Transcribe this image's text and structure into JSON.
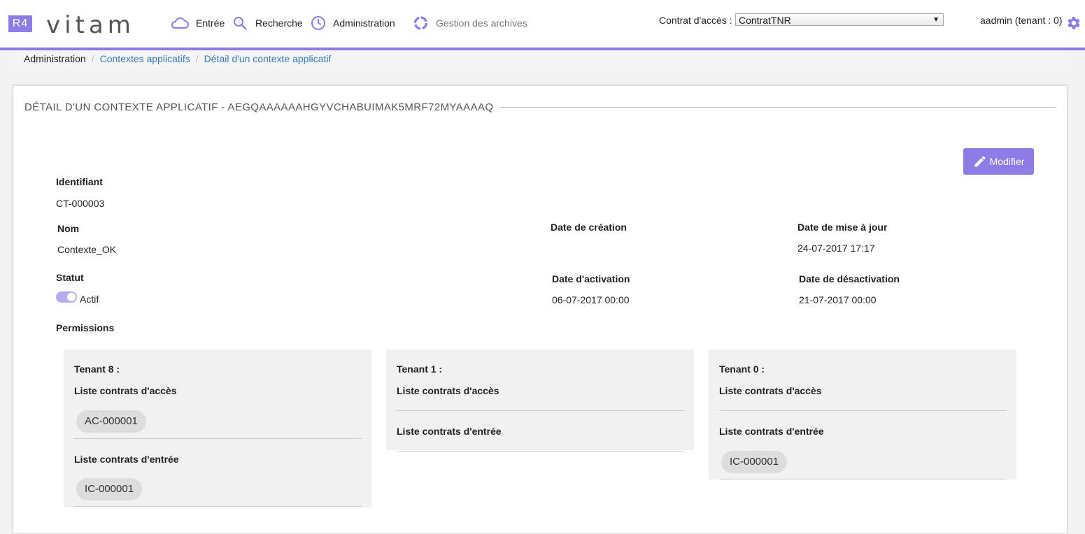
{
  "header": {
    "logo_badge": "R4",
    "logo_text": "vitam",
    "nav": [
      {
        "label": "Entrée",
        "icon": "cloud-icon"
      },
      {
        "label": "Recherche",
        "icon": "search-icon"
      },
      {
        "label": "Administration",
        "icon": "clock-icon"
      },
      {
        "label": "Gestion des archives",
        "icon": "ring-icon"
      }
    ],
    "contract_label": "Contrat d'accès :",
    "contract_value": "ContratTNR",
    "user_label": "aadmin (tenant : 0)",
    "accent_color": "#8e7be6"
  },
  "breadcrumb": {
    "items": [
      "Administration",
      "Contextes applicatifs",
      "Détail d'un contexte applicatif"
    ]
  },
  "detail": {
    "title": "DÉTAIL D'UN CONTEXTE APPLICATIF - AEGQAAAAAAHGYVCHABUIMAK5MRF72MYAAAAQ",
    "edit_label": "Modifier",
    "identifiant_label": "Identifiant",
    "identifiant_value": "CT-000003",
    "nom_label": "Nom",
    "nom_value": "Contexte_OK",
    "date_creation_label": "Date de création",
    "date_creation_value": "",
    "date_maj_label": "Date de mise à jour",
    "date_maj_value": "24-07-2017 17:17",
    "statut_label": "Statut",
    "statut_value": "Actif",
    "statut_active": true,
    "date_activation_label": "Date d'activation",
    "date_activation_value": "06-07-2017 00:00",
    "date_desactivation_label": "Date de désactivation",
    "date_desactivation_value": "21-07-2017 00:00",
    "permissions_label": "Permissions"
  },
  "permissions": [
    {
      "tenant": "Tenant 8 :",
      "access_label": "Liste contrats d'accès",
      "access_contracts": [
        "AC-000001"
      ],
      "ingest_label": "Liste contrats d'entrée",
      "ingest_contracts": [
        "IC-000001"
      ]
    },
    {
      "tenant": "Tenant 1 :",
      "access_label": "Liste contrats d'accès",
      "access_contracts": [],
      "ingest_label": "Liste contrats d'entrée",
      "ingest_contracts": []
    },
    {
      "tenant": "Tenant 0 :",
      "access_label": "Liste contrats d'accès",
      "access_contracts": [],
      "ingest_label": "Liste contrats d'entrée",
      "ingest_contracts": [
        "IC-000001"
      ]
    }
  ]
}
